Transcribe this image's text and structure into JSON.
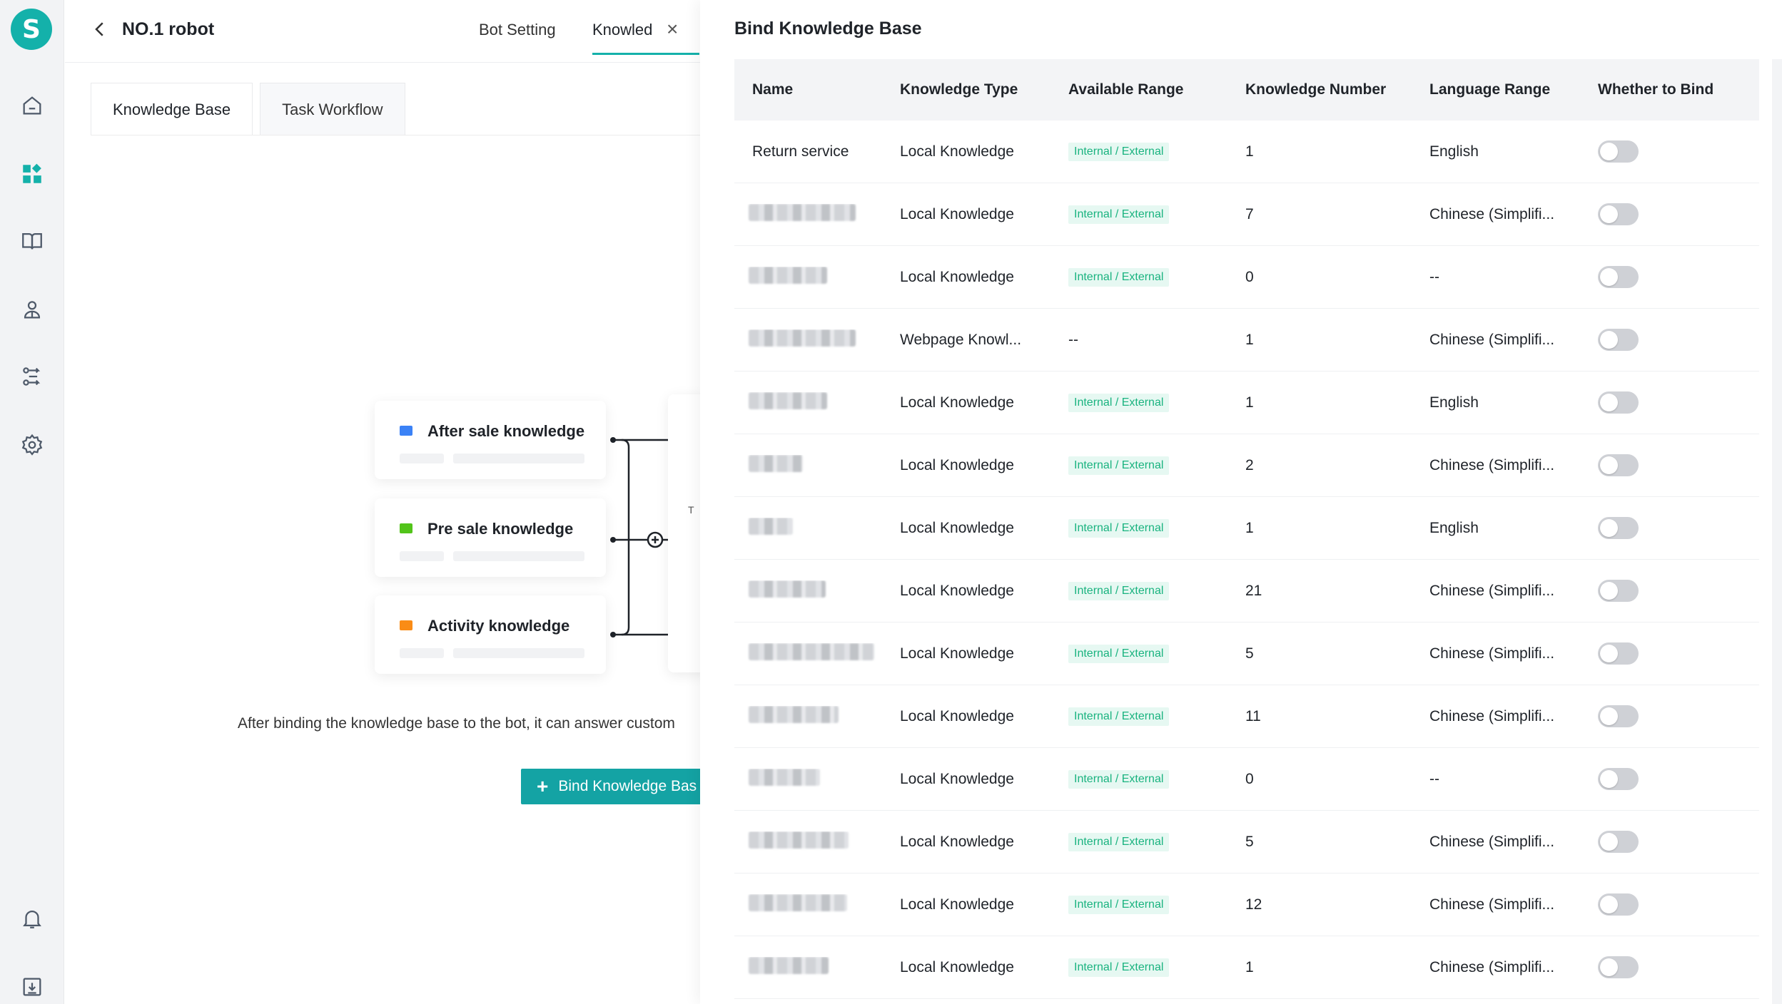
{
  "app": {
    "logo_letter": "S",
    "accent": "#14b1aa"
  },
  "rail": {
    "icons": [
      "home-icon",
      "apps-icon",
      "book-icon",
      "contacts-icon",
      "workflow-icon",
      "settings-icon",
      "bell-icon",
      "download-icon"
    ]
  },
  "header": {
    "robot_name": "NO.1 robot",
    "tabs": [
      {
        "label": "Bot Setting"
      },
      {
        "label": "Knowled"
      }
    ]
  },
  "subtabs": [
    {
      "label": "Knowledge Base"
    },
    {
      "label": "Task Workflow"
    }
  ],
  "illustration": {
    "cards": [
      {
        "label": "After sale knowledge",
        "color": "#3b82f6"
      },
      {
        "label": "Pre sale knowledge",
        "color": "#52c41a"
      },
      {
        "label": "Activity knowledge",
        "color": "#fa8c16"
      }
    ],
    "ghost_letter": "T"
  },
  "empty_state": {
    "description": "After binding the knowledge base to the bot, it can answer custom",
    "bind_button": "Bind Knowledge Bas"
  },
  "drawer": {
    "title": "Bind Knowledge Base",
    "columns": [
      "Name",
      "Knowledge Type",
      "Available Range",
      "Knowledge Number",
      "Language Range",
      "Whether to Bind"
    ],
    "rows": [
      {
        "name": "Return service",
        "type": "Local Knowledge",
        "range": "Internal / External",
        "number": "1",
        "language": "English",
        "bound": false
      },
      {
        "name": "",
        "type": "Local Knowledge",
        "range": "Internal / External",
        "number": "7",
        "language": "Chinese (Simplifi...",
        "bound": false
      },
      {
        "name": "",
        "type": "Local Knowledge",
        "range": "Internal / External",
        "number": "0",
        "language": "--",
        "bound": false
      },
      {
        "name": "",
        "type": "Webpage Knowl...",
        "range": "--",
        "number": "1",
        "language": "Chinese (Simplifi...",
        "bound": false
      },
      {
        "name": "",
        "type": "Local Knowledge",
        "range": "Internal / External",
        "number": "1",
        "language": "English",
        "bound": false
      },
      {
        "name": "",
        "type": "Local Knowledge",
        "range": "Internal / External",
        "number": "2",
        "language": "Chinese (Simplifi...",
        "bound": false
      },
      {
        "name": "",
        "type": "Local Knowledge",
        "range": "Internal / External",
        "number": "1",
        "language": "English",
        "bound": false
      },
      {
        "name": "",
        "type": "Local Knowledge",
        "range": "Internal / External",
        "number": "21",
        "language": "Chinese (Simplifi...",
        "bound": false
      },
      {
        "name": "",
        "type": "Local Knowledge",
        "range": "Internal / External",
        "number": "5",
        "language": "Chinese (Simplifi...",
        "bound": false
      },
      {
        "name": "",
        "type": "Local Knowledge",
        "range": "Internal / External",
        "number": "11",
        "language": "Chinese (Simplifi...",
        "bound": false
      },
      {
        "name": "",
        "type": "Local Knowledge",
        "range": "Internal / External",
        "number": "0",
        "language": "--",
        "bound": false
      },
      {
        "name": "",
        "type": "Local Knowledge",
        "range": "Internal / External",
        "number": "5",
        "language": "Chinese (Simplifi...",
        "bound": false
      },
      {
        "name": "",
        "type": "Local Knowledge",
        "range": "Internal / External",
        "number": "12",
        "language": "Chinese (Simplifi...",
        "bound": false
      },
      {
        "name": "",
        "type": "Local Knowledge",
        "range": "Internal / External",
        "number": "1",
        "language": "Chinese (Simplifi...",
        "bound": false
      }
    ]
  }
}
